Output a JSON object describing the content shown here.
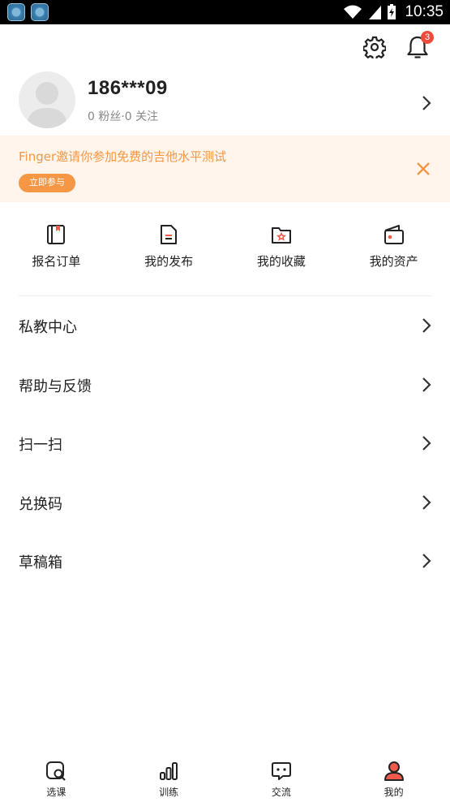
{
  "status_bar": {
    "time": "10:35"
  },
  "header": {
    "notification_count": "3"
  },
  "profile": {
    "username": "186***09",
    "stats": "0 粉丝·0 关注"
  },
  "banner": {
    "text": "Finger邀请你参加免费的吉他水平测试",
    "button_label": "立即参与"
  },
  "quick_actions": [
    {
      "label": "报名订单",
      "icon": "order-book-icon"
    },
    {
      "label": "我的发布",
      "icon": "document-icon"
    },
    {
      "label": "我的收藏",
      "icon": "favorites-folder-icon"
    },
    {
      "label": "我的资产",
      "icon": "wallet-icon"
    }
  ],
  "menu": [
    {
      "label": "私教中心"
    },
    {
      "label": "帮助与反馈"
    },
    {
      "label": "扫一扫"
    },
    {
      "label": "兑换码"
    },
    {
      "label": "草稿箱"
    }
  ],
  "bottom_nav": [
    {
      "label": "选课",
      "icon": "course-search-icon"
    },
    {
      "label": "训练",
      "icon": "bar-chart-icon"
    },
    {
      "label": "交流",
      "icon": "chat-bubble-icon"
    },
    {
      "label": "我的",
      "icon": "user-icon",
      "active": true
    }
  ],
  "colors": {
    "accent": "#f59745",
    "banner_bg": "#fff5ec",
    "badge": "#ef4b3a",
    "active_nav": "#ef5a4c"
  }
}
